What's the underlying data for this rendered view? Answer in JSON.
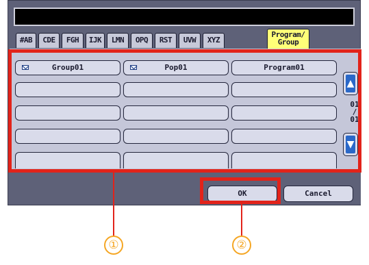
{
  "tabs": [
    "#AB",
    "CDE",
    "FGH",
    "IJK",
    "LMN",
    "OPQ",
    "RST",
    "UVW",
    "XYZ",
    "Program/\nGroup"
  ],
  "active_tab": "Program/\nGroup",
  "cells": {
    "group01": "Group01",
    "pop01": "Pop01",
    "program01": "Program01"
  },
  "page_indicator": {
    "current": "01",
    "sep": "/",
    "total": "01"
  },
  "scroll": {
    "up_glyph": "▲",
    "down_glyph": "▼"
  },
  "buttons": {
    "ok": "OK",
    "cancel": "Cancel"
  },
  "callouts": {
    "one": "①",
    "two": "②"
  },
  "colors": {
    "panel": "#5e6178",
    "tab_active": "#ffff78",
    "highlight": "#e2231a",
    "callout": "#f5a623"
  }
}
